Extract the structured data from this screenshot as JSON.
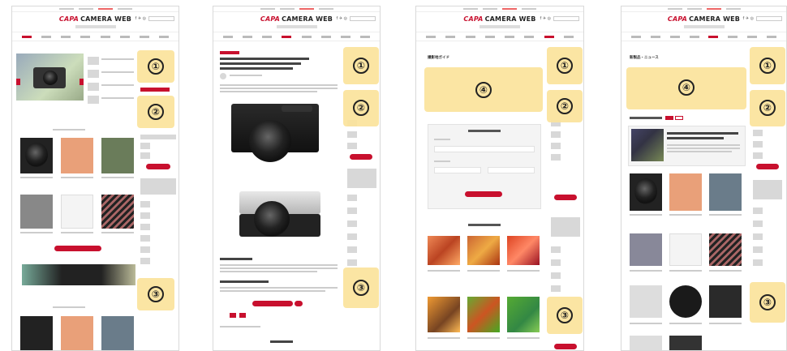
{
  "site": {
    "logo_brand": "CAPA",
    "logo_text": "CAMERA WEB",
    "social": "f ✈ ◎"
  },
  "badges": {
    "one": "①",
    "two": "②",
    "three": "③",
    "four": "④"
  },
  "page3": {
    "section_title": "撮影地ガイド"
  },
  "page4": {
    "section_title": "新製品・ニュース"
  },
  "colors": {
    "accent": "#c8102e",
    "highlight": "#fbe39b"
  }
}
